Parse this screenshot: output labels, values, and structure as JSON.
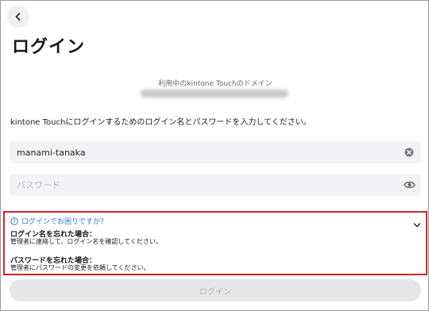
{
  "header": {
    "back_icon": "chevron-left-icon",
    "title": "ログイン"
  },
  "domain": {
    "caption": "利用中のkintone Touchのドメイン"
  },
  "instruction": "kintone Touchにログインするためのログイン名とパスワードを入力してください。",
  "username_field": {
    "value": "manami-tanaka",
    "clear_icon": "clear-circle-icon"
  },
  "password_field": {
    "placeholder": "パスワード",
    "toggle_icon": "eye-icon"
  },
  "help": {
    "toggle_label": "ログインでお困りですか？",
    "toggle_icon": "help-circle-icon",
    "expand_icon": "chevron-down-icon",
    "forgot_username_heading": "ログイン名を忘れた場合：",
    "forgot_username_body": "管理者に連絡して、ログイン名を確認してください。",
    "forgot_password_heading": "パスワードを忘れた場合：",
    "forgot_password_body": "管理者にパスワードの変更を依頼してください。"
  },
  "login_button": {
    "label": "ログイン"
  },
  "colors": {
    "highlight_border": "#d3232c",
    "link_blue": "#2b7cd3",
    "disabled_button": "#e6e6e8"
  }
}
